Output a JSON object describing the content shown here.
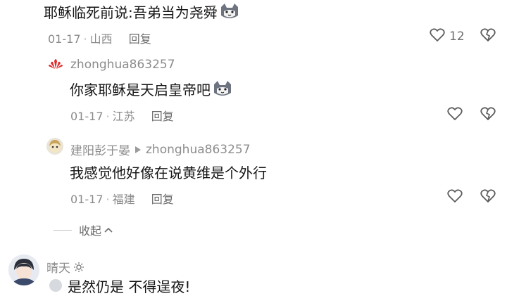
{
  "comments": [
    {
      "text": "耶稣临死前说:吾弟当为尧舜",
      "date": "01-17",
      "location": "山西",
      "reply_label": "回复",
      "like_count": "12"
    },
    {
      "username": "zhonghua863257",
      "text": "你家耶稣是天启皇帝吧",
      "date": "01-17",
      "location": "江苏",
      "reply_label": "回复"
    },
    {
      "username": "建阳彭于晏",
      "reply_to": "zhonghua863257",
      "text": "我感觉他好像在说黄维是个外行",
      "date": "01-17",
      "location": "福建",
      "reply_label": "回复"
    }
  ],
  "collapse_label": "收起",
  "next_comment": {
    "username": "晴天",
    "text_partial": "是然仍是 不得逞夜!"
  },
  "meta_separator": "·",
  "colors": {
    "text": "#161616",
    "meta": "#8a8a8a",
    "huawei_red": "#e02c2c"
  }
}
